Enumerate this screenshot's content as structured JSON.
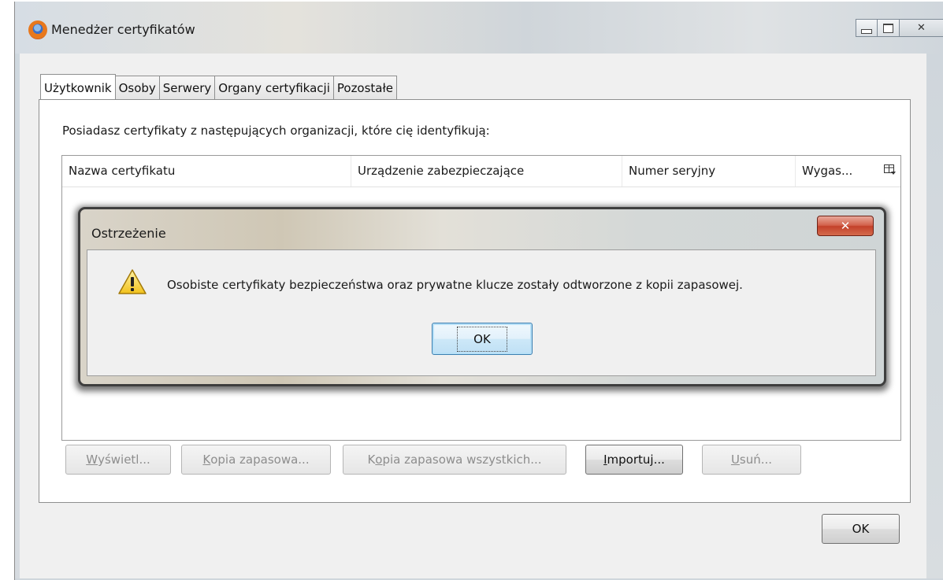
{
  "window": {
    "title": "Menedżer certyfikatów"
  },
  "tabs": [
    {
      "label": "Użytkownik",
      "active": true
    },
    {
      "label": "Osoby"
    },
    {
      "label": "Serwery"
    },
    {
      "label": "Organy certyfikacji"
    },
    {
      "label": "Pozostałe"
    }
  ],
  "panel": {
    "description": "Posiadasz certyfikaty z następujących organizacji, które cię identyfikują:",
    "columns": [
      "Nazwa certyfikatu",
      "Urządzenie zabezpieczające",
      "Numer seryjny",
      "Wygas..."
    ]
  },
  "buttons": {
    "view": {
      "label": "Wyświetl...",
      "accel": "W",
      "rest": "yświetl...",
      "enabled": false
    },
    "backup": {
      "label": "Kopia zapasowa...",
      "accel": "K",
      "rest": "opia zapasowa...",
      "enabled": false
    },
    "backup_all": {
      "label": "Kopia zapasowa wszystkich...",
      "pre": "K",
      "accel": "o",
      "rest": "pia zapasowa wszystkich...",
      "enabled": false
    },
    "import": {
      "label": "Importuj...",
      "accel": "I",
      "rest": "mportuj...",
      "enabled": true
    },
    "delete": {
      "label": "Usuń...",
      "accel": "U",
      "rest": "suń...",
      "enabled": false
    },
    "ok": "OK"
  },
  "dialog": {
    "title": "Ostrzeżenie",
    "message": "Osobiste certyfikaty bezpieczeństwa oraz prywatne klucze zostały odtworzone z kopii zapasowej.",
    "ok": "OK",
    "icon": "warning-icon"
  }
}
